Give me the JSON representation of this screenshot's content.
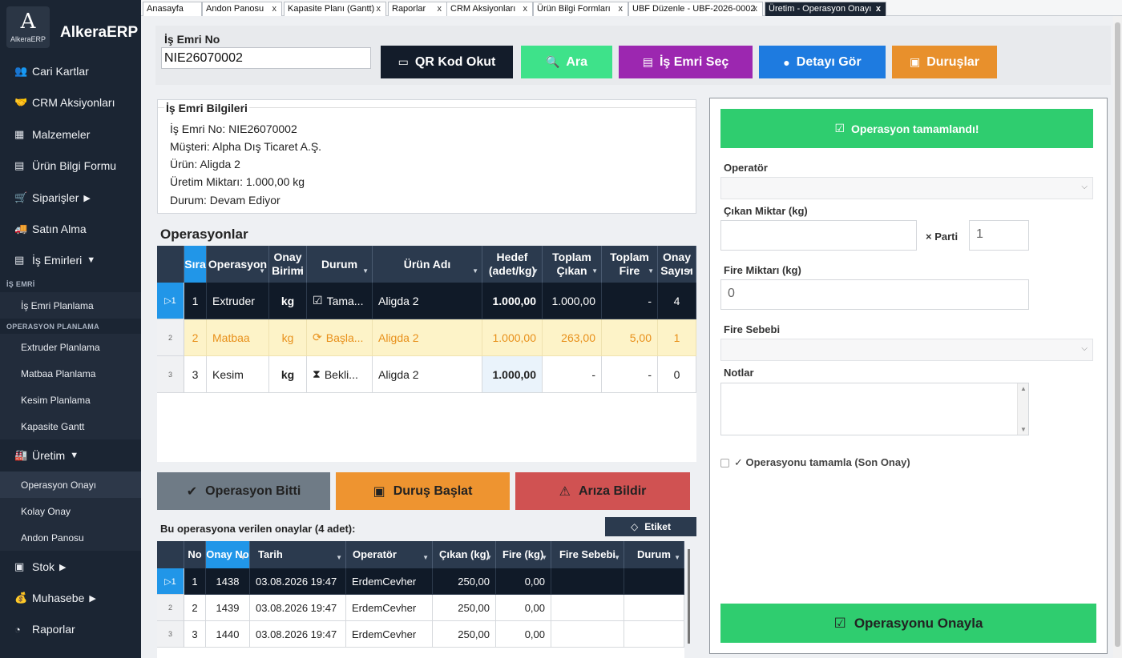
{
  "app": {
    "logo_mark": "A",
    "logo_sub": "AlkeraERP",
    "title": "AlkeraERP"
  },
  "sidebar": {
    "items": [
      {
        "label": "Cari Kartlar",
        "icon": "users-icon",
        "glyph": "👥"
      },
      {
        "label": "CRM Aksiyonları",
        "icon": "handshake-icon",
        "glyph": "🤝"
      },
      {
        "label": "Malzemeler",
        "icon": "boxes-icon",
        "glyph": "▦"
      },
      {
        "label": "Ürün Bilgi Formu",
        "icon": "clipboard-icon",
        "glyph": "▤"
      },
      {
        "label": "Siparişler",
        "icon": "cart-icon",
        "glyph": "🛒",
        "arrow": "▶"
      },
      {
        "label": "Satın Alma",
        "icon": "truck-icon",
        "glyph": "🚚"
      },
      {
        "label": "İş Emirleri",
        "icon": "clipboard-list-icon",
        "glyph": "▤",
        "arrow": "▼"
      }
    ],
    "section_is_emri": "İŞ EMRİ",
    "sub_is_emri_planlama": "İş Emri Planlama",
    "section_operasyon_planlama": "OPERASYON PLANLAMA",
    "sub_planning": [
      "Extruder Planlama",
      "Matbaa Planlama",
      "Kesim Planlama",
      "Kapasite Gantt"
    ],
    "uretim": {
      "label": "Üretim",
      "icon": "factory-icon",
      "glyph": "🏭",
      "arrow": "▼"
    },
    "sub_uretim": [
      "Operasyon Onayı",
      "Kolay Onay",
      "Andon Panosu"
    ],
    "bottom_items": [
      {
        "label": "Stok",
        "icon": "chart-icon",
        "glyph": "▣",
        "arrow": "▶"
      },
      {
        "label": "Muhasebe",
        "icon": "money-icon",
        "glyph": "💰",
        "arrow": "▶"
      },
      {
        "label": "Raporlar",
        "icon": "report-icon",
        "glyph": "◔"
      }
    ]
  },
  "tabs": [
    {
      "label": "Anasayfa"
    },
    {
      "label": "Andon Panosu",
      "close": "x"
    },
    {
      "label": "Kapasite Planı (Gantt)",
      "close": "x"
    },
    {
      "label": "Raporlar",
      "close": "x"
    },
    {
      "label": "CRM Aksiyonları",
      "close": "x"
    },
    {
      "label": "Ürün Bilgi Formları",
      "close": "x"
    },
    {
      "label": "UBF Düzenle - UBF-2026-0002",
      "close": "x"
    },
    {
      "label": "Üretim - Operasyon Onayı",
      "close": "x",
      "active": true
    }
  ],
  "work_order": {
    "label": "İş Emri No",
    "value": "NIE26070002"
  },
  "buttons": {
    "qr": {
      "label": "QR Kod Okut",
      "icon": "qr-card-icon",
      "color": "#131c2a"
    },
    "search": {
      "label": "Ara",
      "icon": "search-icon",
      "color": "#3ee28a"
    },
    "select": {
      "label": "İş Emri Seç",
      "icon": "document-icon",
      "color": "#9c27b0"
    },
    "detail": {
      "label": "Detayı Gör",
      "icon": "magnifier-icon",
      "color": "#1e7be0"
    },
    "stops": {
      "label": "Duruşlar",
      "icon": "stop-icon",
      "color": "#e8902c"
    }
  },
  "info": {
    "title": "İş Emri Bilgileri",
    "lines": [
      "İş Emri No: NIE26070002",
      "Müşteri: Alpha Dış Ticaret A.Ş.",
      "Ürün: Aligda 2",
      "Üretim Miktarı: 1.000,00 kg",
      "Durum: Devam Ediyor"
    ]
  },
  "operations": {
    "title": "Operasyonlar",
    "headers": [
      "Sıra",
      "Operasyon",
      "Onay Birimi",
      "Durum",
      "Ürün Adı",
      "Hedef (adet/kg)",
      "Toplam Çıkan",
      "Toplam Fire",
      "Onay Sayısı"
    ],
    "rows": [
      {
        "rownum": "▷1",
        "sira": "1",
        "op": "Extruder",
        "unit": "kg",
        "status_icon": "☑",
        "status": "Tama...",
        "product": "Aligda 2",
        "target": "1.000,00",
        "out": "1.000,00",
        "fire": "-",
        "count": "4"
      },
      {
        "rownum": "2",
        "sira": "2",
        "op": "Matbaa",
        "unit": "kg",
        "status_icon": "⟳",
        "status": "Başla...",
        "product": "Aligda 2",
        "target": "1.000,00",
        "out": "263,00",
        "fire": "5,00",
        "count": "1"
      },
      {
        "rownum": "3",
        "sira": "3",
        "op": "Kesim",
        "unit": "kg",
        "status_icon": "⧗",
        "status": "Bekli...",
        "product": "Aligda 2",
        "target": "1.000,00",
        "out": "-",
        "fire": "-",
        "count": "0"
      }
    ]
  },
  "actions": {
    "finish": {
      "label": "Operasyon Bitti",
      "icon": "check-icon",
      "color": "#6f7b86"
    },
    "stop": {
      "label": "Duruş Başlat",
      "icon": "stop-square-icon",
      "color": "#ee9430"
    },
    "fault": {
      "label": "Arıza Bildir",
      "icon": "warning-icon",
      "color": "#d05252"
    }
  },
  "approvals": {
    "label": "Bu operasyona verilen onaylar (4 adet):",
    "etiket": "Etiket",
    "headers": [
      "No",
      "Onay No",
      "Tarih",
      "Operatör",
      "Çıkan (kg)",
      "Fire (kg)",
      "Fire Sebebi",
      "Durum"
    ],
    "rows": [
      {
        "rownum": "▷1",
        "no": "1",
        "onay": "1438",
        "date": "03.08.2026 19:47",
        "op": "ErdemCevher",
        "out": "250,00",
        "fire": "0,00",
        "reason": "",
        "status": ""
      },
      {
        "rownum": "2",
        "no": "2",
        "onay": "1439",
        "date": "03.08.2026 19:47",
        "op": "ErdemCevher",
        "out": "250,00",
        "fire": "0,00",
        "reason": "",
        "status": ""
      },
      {
        "rownum": "3",
        "no": "3",
        "onay": "1440",
        "date": "03.08.2026 19:47",
        "op": "ErdemCevher",
        "out": "250,00",
        "fire": "0,00",
        "reason": "",
        "status": ""
      }
    ]
  },
  "right": {
    "banner": "Operasyon tamamlandı!",
    "operator_label": "Operatör",
    "out_label": "Çıkan Miktar (kg)",
    "parti_label": "× Parti",
    "parti_value": "1",
    "fire_label": "Fire Miktarı (kg)",
    "fire_value": "0",
    "fire_reason_label": "Fire Sebebi",
    "notes_label": "Notlar",
    "complete_label": "✓ Operasyonu tamamla (Son Onay)",
    "approve": "Operasyonu Onayla",
    "banner_color": "#2fcd6f"
  }
}
